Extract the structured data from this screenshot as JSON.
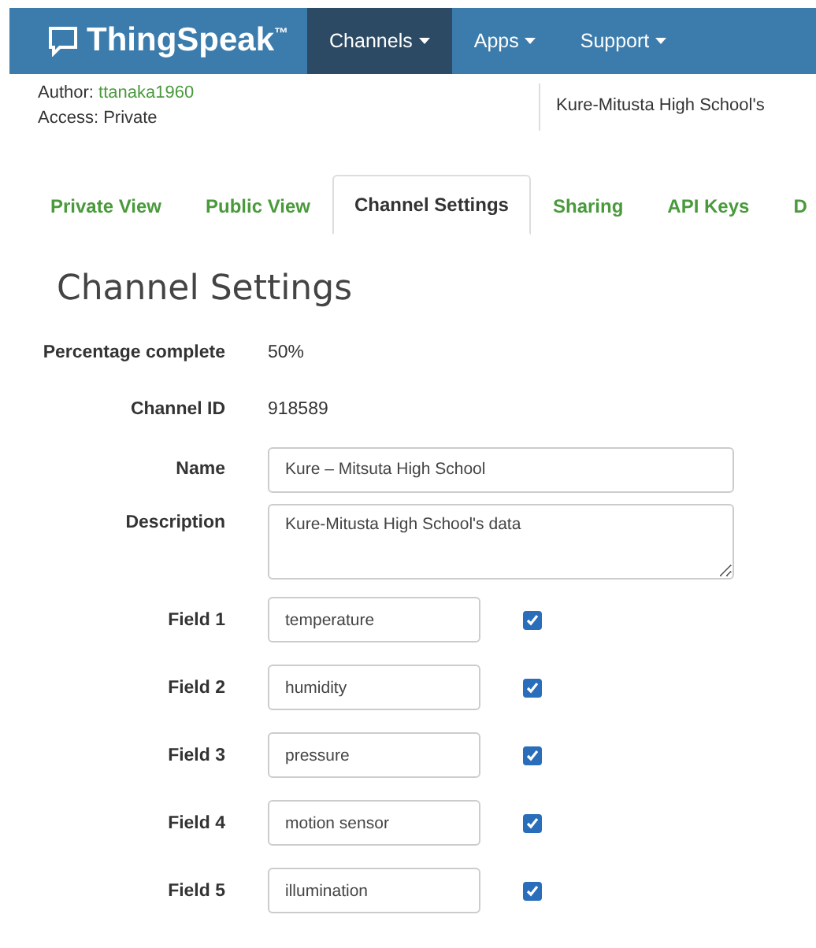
{
  "navbar": {
    "logo": "ThingSpeak",
    "trademark": "™",
    "menus": [
      {
        "label": "Channels",
        "selected": true
      },
      {
        "label": "Apps",
        "selected": false
      },
      {
        "label": "Support",
        "selected": false
      }
    ]
  },
  "channel_info": {
    "author_label": "Author:",
    "author": "ttanaka1960",
    "access": "Access: Private",
    "description": "Kure-Mitusta High School's"
  },
  "tabs": [
    {
      "label": "Private View",
      "selected": false
    },
    {
      "label": "Public View",
      "selected": false
    },
    {
      "label": "Channel Settings",
      "selected": true
    },
    {
      "label": "Sharing",
      "selected": false
    },
    {
      "label": "API Keys",
      "selected": false
    },
    {
      "label": "D",
      "selected": false
    }
  ],
  "heading": "Channel Settings",
  "info_rows": [
    {
      "label": "Percentage complete",
      "value": "50%"
    },
    {
      "label": "Channel ID",
      "value": "918589"
    }
  ],
  "name": {
    "label": "Name",
    "value": "Kure – Mitsuta High School"
  },
  "description": {
    "label": "Description",
    "value": "Kure-Mitusta High School's data"
  },
  "fields": [
    {
      "label": "Field 1",
      "value": "temperature",
      "checked": true
    },
    {
      "label": "Field 2",
      "value": "humidity",
      "checked": true
    },
    {
      "label": "Field 3",
      "value": "pressure",
      "checked": true
    },
    {
      "label": "Field 4",
      "value": "motion sensor",
      "checked": true
    },
    {
      "label": "Field 5",
      "value": "illumination",
      "checked": true
    }
  ]
}
